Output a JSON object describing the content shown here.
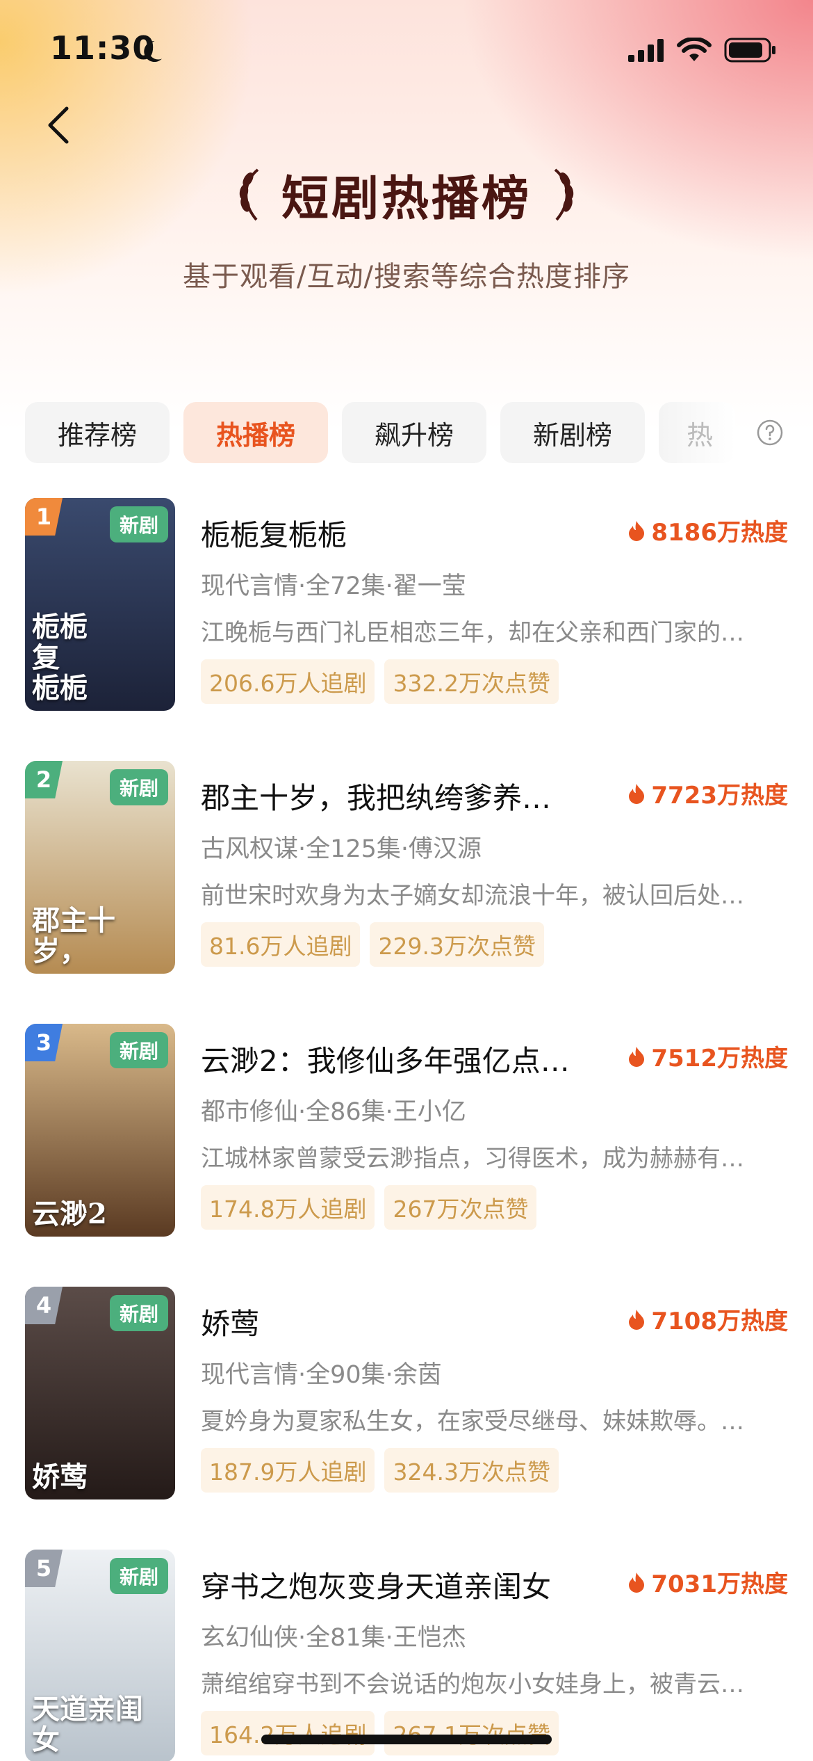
{
  "status_bar": {
    "time": "11:30"
  },
  "header": {
    "title": "短剧热播榜",
    "subtitle": "基于观看/互动/搜索等综合热度排序"
  },
  "tabs": [
    {
      "label": "推荐榜",
      "active": false
    },
    {
      "label": "热播榜",
      "active": true
    },
    {
      "label": "飙升榜",
      "active": false
    },
    {
      "label": "新剧榜",
      "active": false
    },
    {
      "label": "热",
      "active": false
    }
  ],
  "items": [
    {
      "rank": "1",
      "tag": "新剧",
      "rank_color": "#f08a3c",
      "poster_text": "栀栀\n复\n栀栀",
      "poster_colors": [
        "#3a4a6e",
        "#1c2238"
      ],
      "name": "栀栀复栀栀",
      "heat": "8186万热度",
      "meta": "现代言情·全72集·翟一莹",
      "desc": "江晚栀与西门礼臣相恋三年，却在父亲和西门家的…",
      "followers": "206.6万人追剧",
      "likes": "332.2万次点赞"
    },
    {
      "rank": "2",
      "tag": "新剧",
      "rank_color": "#4caf7d",
      "poster_text": "郡主十岁，",
      "poster_colors": [
        "#e9e2cf",
        "#b58b52"
      ],
      "name": "郡主十岁，我把纨绔爹养…",
      "heat": "7723万热度",
      "meta": "古风权谋·全125集·傅汉源",
      "desc": "前世宋时欢身为太子嫡女却流浪十年，被认回后处…",
      "followers": "81.6万人追剧",
      "likes": "229.3万次点赞"
    },
    {
      "rank": "3",
      "tag": "新剧",
      "rank_color": "#3f7de0",
      "poster_text": "云渺2",
      "poster_colors": [
        "#d9b98a",
        "#5a3a22"
      ],
      "name": "云渺2：我修仙多年强亿点…",
      "heat": "7512万热度",
      "meta": "都市修仙·全86集·王小亿",
      "desc": "江城林家曾蒙受云渺指点，习得医术，成为赫赫有…",
      "followers": "174.8万人追剧",
      "likes": "267万次点赞"
    },
    {
      "rank": "4",
      "tag": "新剧",
      "rank_color": "#9aa0ab",
      "poster_text": "娇莺",
      "poster_colors": [
        "#5b4c48",
        "#241a18"
      ],
      "name": "娇莺",
      "heat": "7108万热度",
      "meta": "现代言情·全90集·余茵",
      "desc": "夏妗身为夏家私生女，在家受尽继母、妹妹欺辱。…",
      "followers": "187.9万人追剧",
      "likes": "324.3万次点赞"
    },
    {
      "rank": "5",
      "tag": "新剧",
      "rank_color": "#9aa0ab",
      "poster_text": "天道亲闺女",
      "poster_colors": [
        "#eef1f4",
        "#b9c3cc"
      ],
      "name": "穿书之炮灰变身天道亲闺女",
      "heat": "7031万热度",
      "meta": "玄幻仙侠·全81集·王恺杰",
      "desc": "萧绾绾穿书到不会说话的炮灰小女娃身上，被青云…",
      "followers": "164.2万人追剧",
      "likes": "267.1万次点赞"
    }
  ]
}
